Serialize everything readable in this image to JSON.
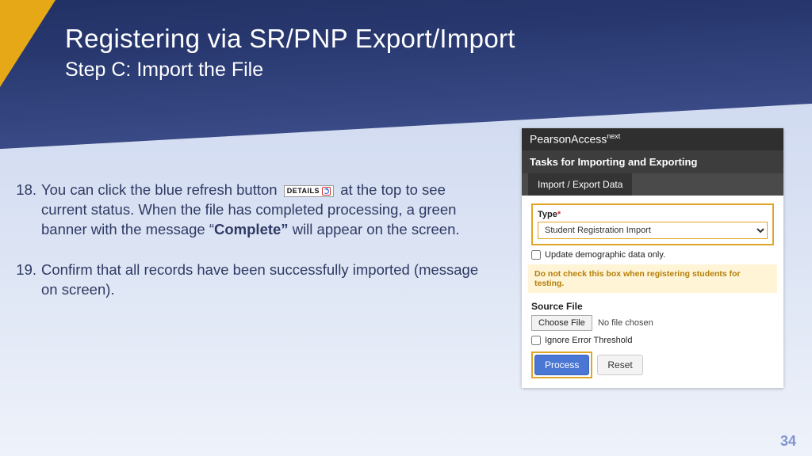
{
  "header": {
    "title": "Registering via SR/PNP Export/Import",
    "subtitle": "Step C: Import the File"
  },
  "steps": [
    {
      "num": "18.",
      "pre": "You can click the blue refresh button ",
      "inline_button": "DETAILS",
      "mid": " at the top to see current status. When the file has completed processing, a green banner with the message “",
      "bold": "Complete”",
      "post": " will appear on the screen."
    },
    {
      "num": "19.",
      "pre": "Confirm that all records have been successfully imported (message on screen)."
    }
  ],
  "pearson": {
    "brand_pre": "PearsonAccess",
    "brand_sup": "next",
    "subtitle": "Tasks for Importing and Exporting",
    "tab": "Import / Export Data",
    "type_label": "Type",
    "type_value": "Student Registration Import",
    "update_label": "Update demographic data only.",
    "warn": "Do not check this box when registering students for testing.",
    "source_label": "Source File",
    "choose_file": "Choose File",
    "no_file": "No file chosen",
    "ignore_label": "Ignore Error Threshold",
    "process": "Process",
    "reset": "Reset"
  },
  "pagenum": "34"
}
